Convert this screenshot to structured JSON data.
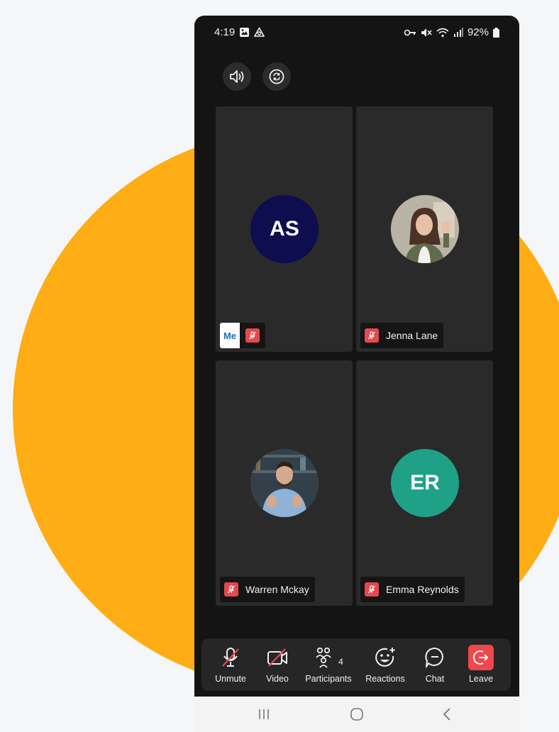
{
  "status_bar": {
    "time": "4:19",
    "battery": "92%"
  },
  "participants": [
    {
      "initials": "AS",
      "name": "",
      "is_me": true,
      "me_label": "Me",
      "avatar_color": "#0d0d4f"
    },
    {
      "initials": "",
      "name": "Jenna Lane",
      "is_me": false,
      "avatar": "photo"
    },
    {
      "initials": "",
      "name": "Warren Mckay",
      "is_me": false,
      "avatar": "photo"
    },
    {
      "initials": "ER",
      "name": "Emma Reynolds",
      "is_me": false,
      "avatar_color": "#1fa187"
    }
  ],
  "toolbar": {
    "unmute": "Unmute",
    "video": "Video",
    "participants": "Participants",
    "participants_count": "4",
    "reactions": "Reactions",
    "chat": "Chat",
    "leave": "Leave",
    "leave_color": "#f0474d"
  },
  "colors": {
    "background": "#f5f6f8",
    "accent_blob": "#ffad14",
    "muted_red": "#e5484d"
  }
}
